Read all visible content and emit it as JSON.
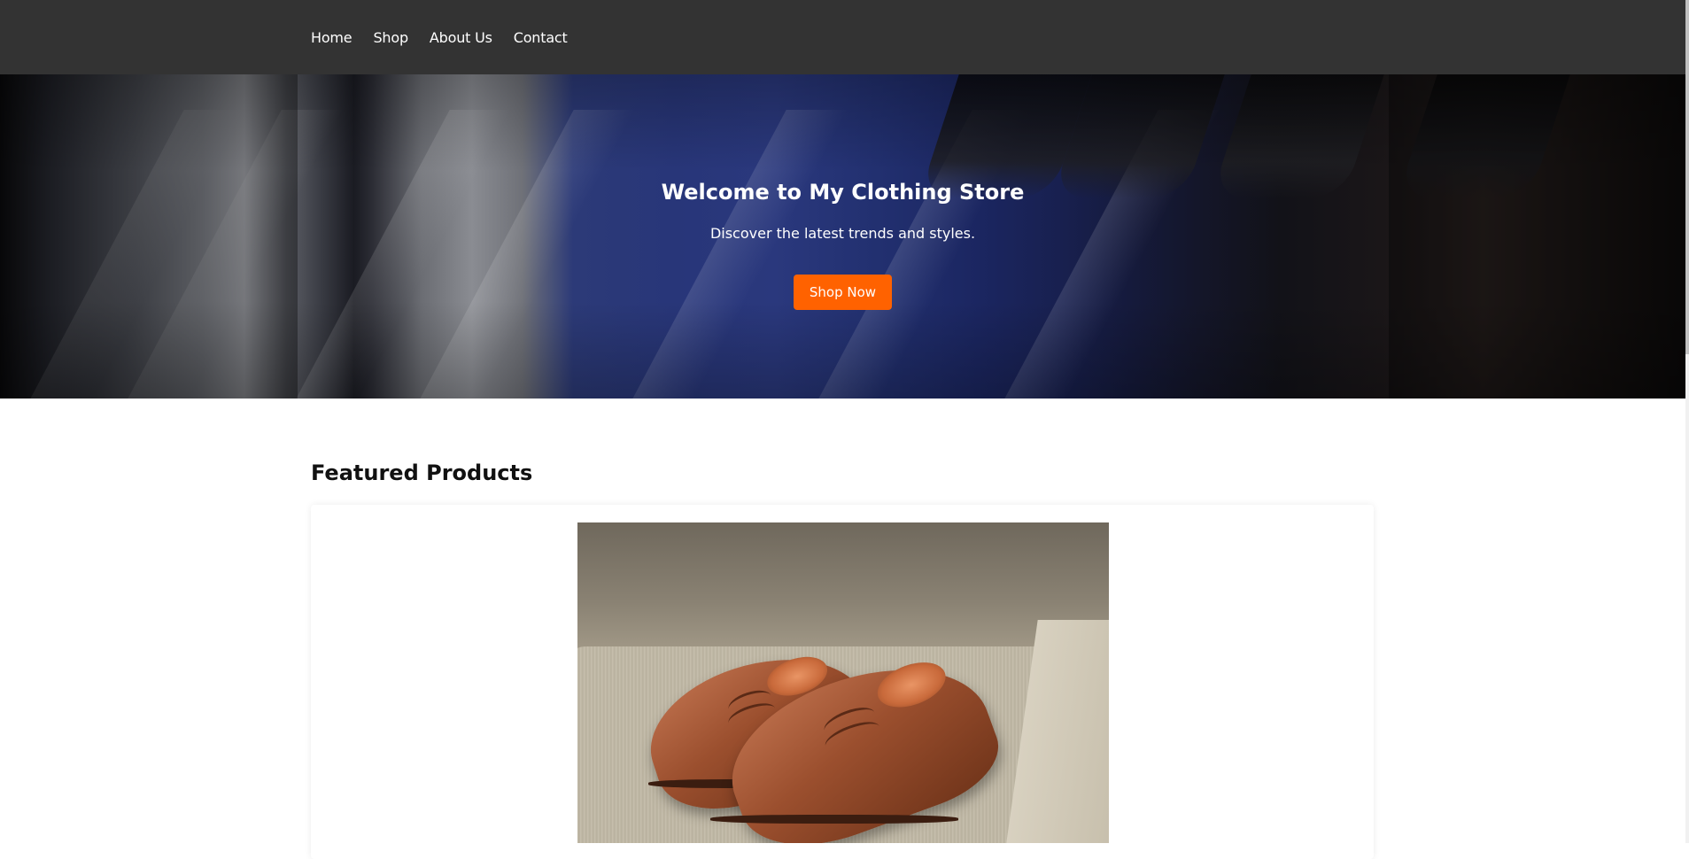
{
  "nav": {
    "items": [
      {
        "label": "Home"
      },
      {
        "label": "Shop"
      },
      {
        "label": "About Us"
      },
      {
        "label": "Contact"
      }
    ]
  },
  "hero": {
    "title": "Welcome to My Clothing Store",
    "subtitle": "Discover the latest trends and styles.",
    "cta_label": "Shop Now",
    "image_icon": "suits-on-hangers-photo"
  },
  "featured": {
    "title": "Featured Products",
    "products": [
      {
        "image_icon": "brown-brogue-shoes-photo"
      }
    ]
  },
  "colors": {
    "header_bg": "#333333",
    "accent": "#ff6200",
    "text_light": "#ffffff"
  }
}
